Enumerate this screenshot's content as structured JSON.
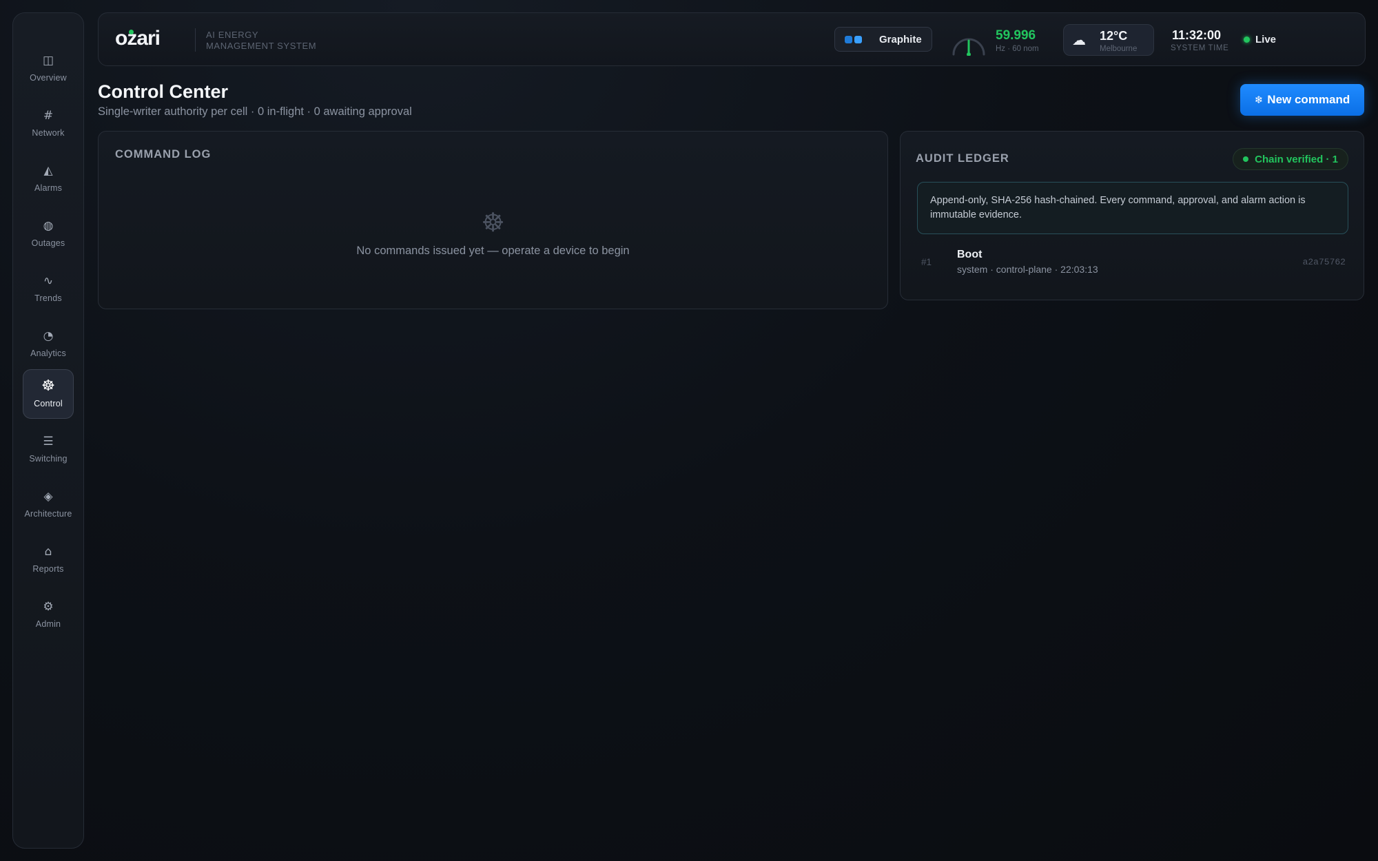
{
  "sidebar": {
    "items": [
      {
        "label": "Overview",
        "icon": "◫",
        "icon_name": "overview-icon"
      },
      {
        "label": "Network",
        "icon": "#",
        "icon_name": "network-icon"
      },
      {
        "label": "Alarms",
        "icon": "◭",
        "icon_name": "alarm-icon"
      },
      {
        "label": "Outages",
        "icon": "◍",
        "icon_name": "outage-icon"
      },
      {
        "label": "Trends",
        "icon": "∿",
        "icon_name": "trends-icon"
      },
      {
        "label": "Analytics",
        "icon": "◔",
        "icon_name": "analytics-icon"
      },
      {
        "label": "Control",
        "icon": "☸",
        "icon_name": "helm-icon",
        "active": true
      },
      {
        "label": "Switching",
        "icon": "☰",
        "icon_name": "switching-icon"
      },
      {
        "label": "Architecture",
        "icon": "◈",
        "icon_name": "architecture-icon"
      },
      {
        "label": "Reports",
        "icon": "⌂",
        "icon_name": "reports-icon"
      },
      {
        "label": "Admin",
        "icon": "⚙",
        "icon_name": "gear-icon"
      }
    ]
  },
  "header": {
    "logo": "ozari",
    "tagline_line1": "AI ENERGY",
    "tagline_line2": "MANAGEMENT SYSTEM",
    "theme_label": "Graphite",
    "frequency": "59.996",
    "frequency_sub": "Hz · 60 nom",
    "weather_icon": "☁",
    "weather_temp": "12°C",
    "weather_city": "Melbourne",
    "time": "11:32:00",
    "time_label": "SYSTEM TIME",
    "live_label": "Live"
  },
  "page": {
    "title": "Control Center",
    "subtitle": "Single-writer authority per cell · 0 in-flight · 0 awaiting approval",
    "new_command_icon": "❄",
    "new_command_label": "New command"
  },
  "command_log": {
    "title": "COMMAND LOG",
    "empty_icon": "☸",
    "empty_text": "No commands issued yet — operate a device to begin"
  },
  "audit_ledger": {
    "title": "AUDIT LEDGER",
    "badge": "Chain verified · 1",
    "info": "Append-only, SHA-256 hash-chained. Every command, approval, and alarm action is immutable evidence.",
    "entries": [
      {
        "index": "#1",
        "name": "Boot",
        "meta": "system · control-plane · 22:03:13",
        "hash": "a2a75762"
      }
    ]
  },
  "colors": {
    "accent": "#1f8bff",
    "status_green": "#22c55e",
    "background": "#0d1117"
  }
}
